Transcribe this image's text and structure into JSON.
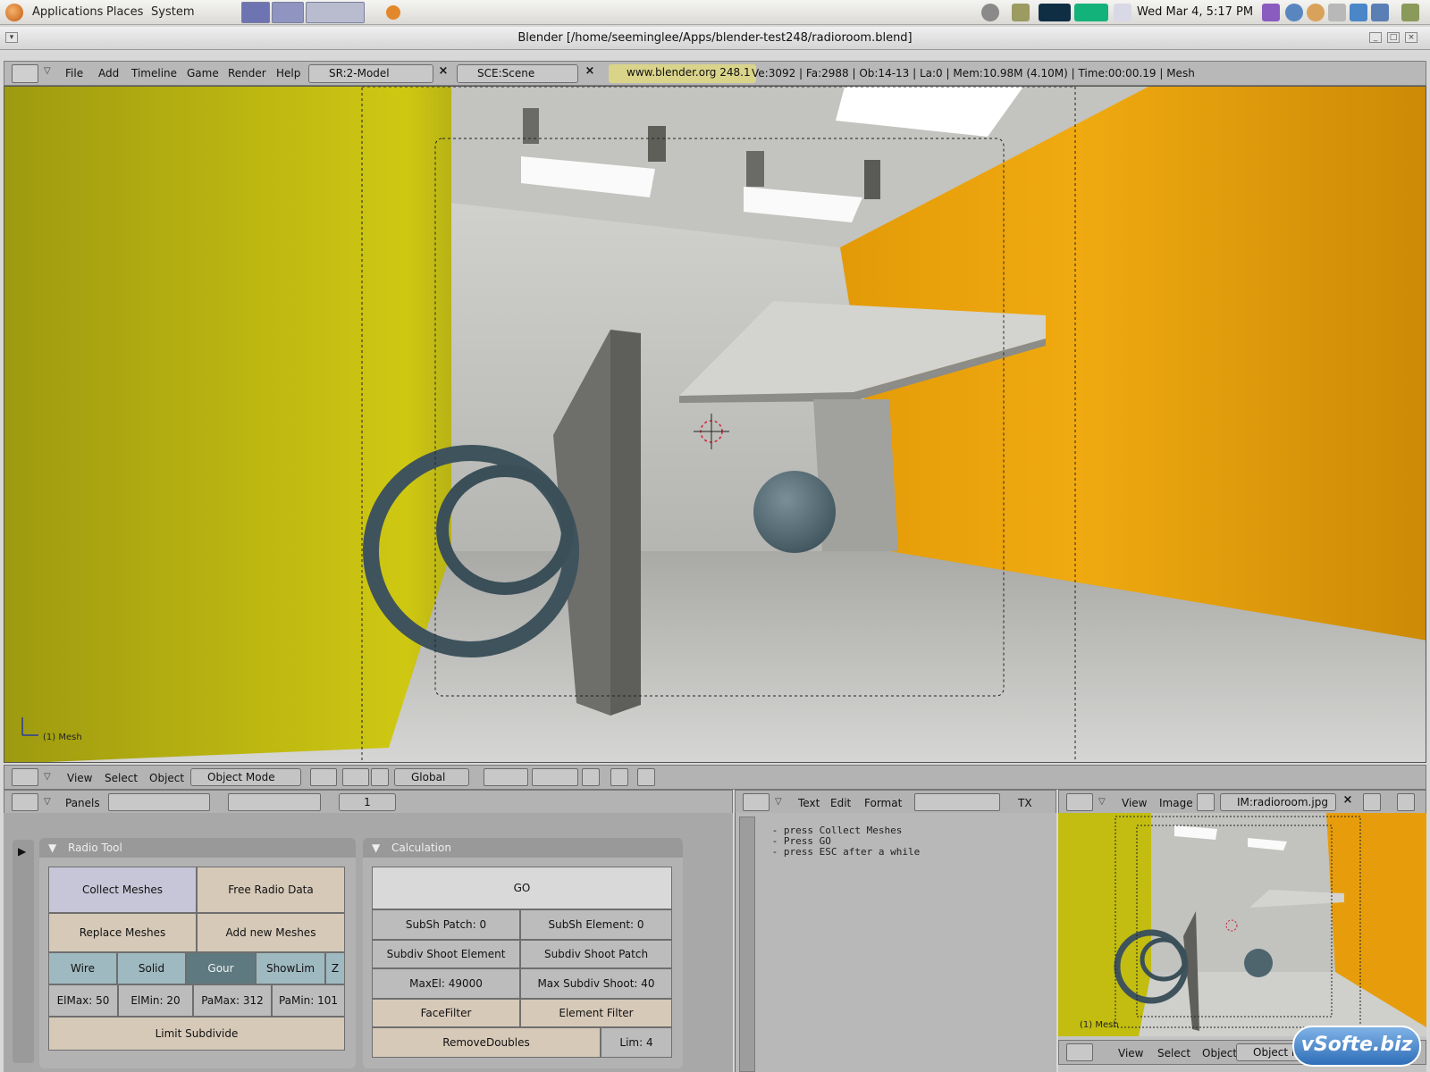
{
  "gnome_panel": {
    "menus": [
      "Applications",
      "Places",
      "System"
    ],
    "clock": "Wed Mar  4,  5:17 PM"
  },
  "window": {
    "title": "Blender [/home/seeminglee/Apps/blender-test248/radioroom.blend]"
  },
  "info_header": {
    "menus": [
      "File",
      "Add",
      "Timeline",
      "Game",
      "Render",
      "Help"
    ],
    "screen": "SR:2-Model",
    "scene": "SCE:Scene",
    "website": "www.blender.org 248.1",
    "stats": "Ve:3092 | Fa:2988 | Ob:14-13 | La:0  | Mem:10.98M (4.10M)  | Time:00:00.19 | Mesh"
  },
  "viewport": {
    "object_label": "(1) Mesh"
  },
  "view3d_header": {
    "menus": [
      "View",
      "Select",
      "Object"
    ],
    "mode": "Object Mode",
    "orientation": "Global"
  },
  "buttons_header": {
    "panels_label": "Panels",
    "frame": "1"
  },
  "radio_tool": {
    "title": "Radio Tool",
    "collect": "Collect Meshes",
    "free": "Free Radio Data",
    "replace": "Replace Meshes",
    "add_new": "Add new Meshes",
    "wire": "Wire",
    "solid": "Solid",
    "gour": "Gour",
    "showlim": "ShowLim",
    "z": "Z",
    "elmax": "ElMax: 50",
    "elmin": "ElMin: 20",
    "pamax": "PaMax: 312",
    "pamin": "PaMin: 101",
    "limit": "Limit Subdivide"
  },
  "calculation": {
    "title": "Calculation",
    "go": "GO",
    "subsh_patch": "SubSh Patch: 0",
    "subsh_element": "SubSh Element: 0",
    "subdiv_shoot_element": "Subdiv Shoot Element",
    "subdiv_shoot_patch": "Subdiv Shoot Patch",
    "maxel": "MaxEl: 49000",
    "max_subdiv_shoot": "Max Subdiv Shoot: 40",
    "facefilter": "FaceFilter",
    "element_filter": "Element Filter",
    "removedoubles": "RemoveDoubles",
    "lim": "Lim: 4"
  },
  "text_editor": {
    "menus": [
      "Text",
      "Edit",
      "Format"
    ],
    "tx": "TX",
    "content": " - press Collect Meshes\n - Press GO\n - press ESC after a while"
  },
  "image_editor": {
    "menus": [
      "View",
      "Image"
    ],
    "image": "IM:radioroom.jpg",
    "bottom_menus": [
      "View",
      "Select",
      "Object"
    ],
    "bottom_mode": "Object M",
    "object_label": "(1) Mesh"
  },
  "watermark": "vSofte.biz",
  "colors": {
    "yellow_wall": "#c2bd10",
    "orange_wall": "#e79d0b",
    "panel_bg": "#a8a8a8",
    "button_tan": "#d6c9b8",
    "button_active": "#5e7a80"
  }
}
